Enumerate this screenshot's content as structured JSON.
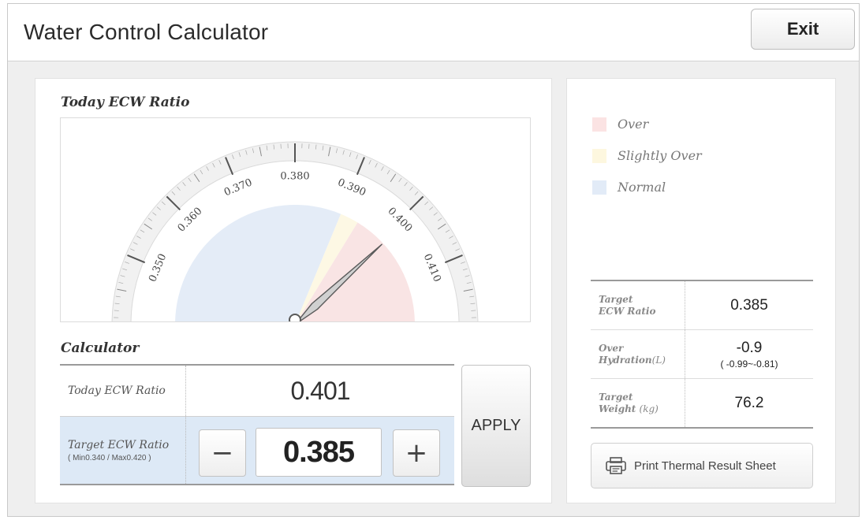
{
  "app": {
    "title": "Water Control Calculator",
    "exit_label": "Exit"
  },
  "gauge": {
    "title": "Today ECW Ratio",
    "ticks": [
      "0.350",
      "0.360",
      "0.370",
      "0.380",
      "0.390",
      "0.400",
      "0.410"
    ],
    "value": 0.401,
    "zones": [
      {
        "name": "Normal",
        "from": 0.34,
        "to": 0.39,
        "color": "#e4ecf7"
      },
      {
        "name": "Slightly Over",
        "from": 0.39,
        "to": 0.394,
        "color": "#fdf8e4"
      },
      {
        "name": "Over",
        "from": 0.394,
        "to": 0.42,
        "color": "#f9e4e4"
      }
    ]
  },
  "calculator": {
    "title": "Calculator",
    "today_label": "Today ECW Ratio",
    "today_value": "0.401",
    "target_label": "Target ECW Ratio",
    "target_range": "( Min0.340 / Max0.420 )",
    "target_value": "0.385",
    "minus_label": "−",
    "plus_label": "+",
    "apply_label": "APPLY"
  },
  "legend": [
    {
      "label": "Over",
      "color": "#fbe3e3"
    },
    {
      "label": "Slightly Over",
      "color": "#fdf7df"
    },
    {
      "label": "Normal",
      "color": "#e2ebf7"
    }
  ],
  "results": {
    "target_ecw_label_1": "Target",
    "target_ecw_label_2": "ECW Ratio",
    "target_ecw_value": "0.385",
    "over_hydration_label_1": "Over",
    "over_hydration_label_2": "Hydration",
    "over_hydration_unit": "(L)",
    "over_hydration_value": "-0.9",
    "over_hydration_range": "( -0.99~-0.81)",
    "target_weight_label_1": "Target",
    "target_weight_label_2": "Weight",
    "target_weight_unit": "(kg)",
    "target_weight_value": "76.2"
  },
  "print_button": {
    "label": "Print Thermal Result Sheet",
    "icon": "printer-icon"
  }
}
